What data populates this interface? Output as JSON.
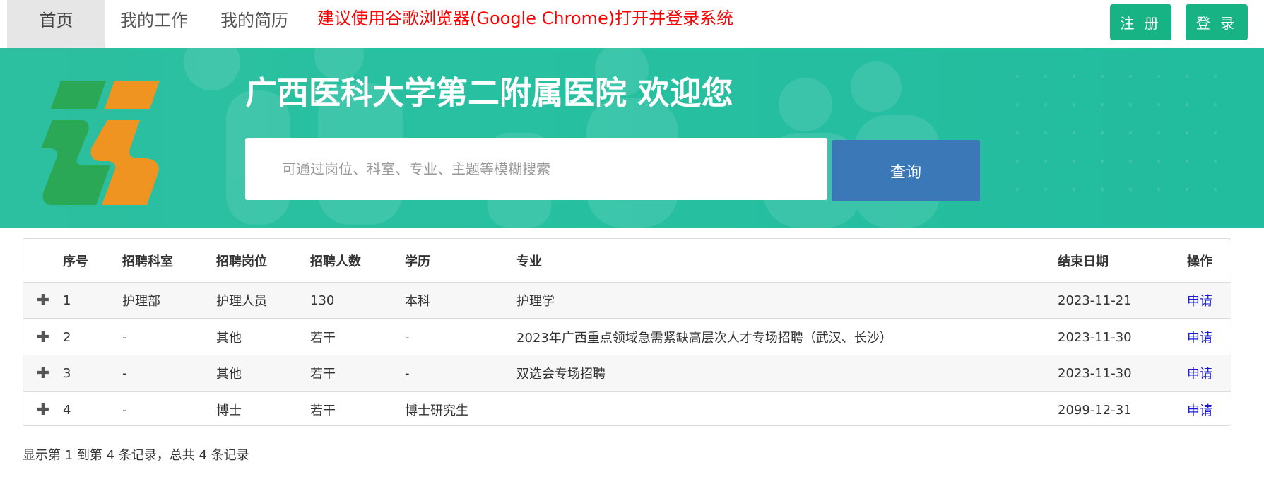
{
  "nav": {
    "home": "首页",
    "my_work": "我的工作",
    "my_resume": "我的简历",
    "notice": "建议使用谷歌浏览器(Google Chrome)打开并登录系统",
    "register": "注 册",
    "login": "登 录"
  },
  "banner": {
    "title": "广西医科大学第二附属医院 欢迎您",
    "search_placeholder": "可通过岗位、科室、专业、主题等模糊搜索",
    "search_button": "查询"
  },
  "table": {
    "headers": [
      "序号",
      "招聘科室",
      "招聘岗位",
      "招聘人数",
      "学历",
      "专业",
      "结束日期",
      "操作"
    ],
    "rows": [
      {
        "expand": "✚",
        "idx": "1",
        "dept": "护理部",
        "position": "护理人员",
        "count": "130",
        "education": "本科",
        "major": "护理学",
        "end_date": "2023-11-21",
        "action": "申请"
      },
      {
        "expand": "✚",
        "idx": "2",
        "dept": "-",
        "position": "其他",
        "count": "若干",
        "education": "-",
        "major": "2023年广西重点领域急需紧缺高层次人才专场招聘（武汉、长沙）",
        "end_date": "2023-11-30",
        "action": "申请"
      },
      {
        "expand": "✚",
        "idx": "3",
        "dept": "-",
        "position": "其他",
        "count": "若干",
        "education": "-",
        "major": "双选会专场招聘",
        "end_date": "2023-11-30",
        "action": "申请"
      },
      {
        "expand": "✚",
        "idx": "4",
        "dept": "-",
        "position": "博士",
        "count": "若干",
        "education": "博士研究生",
        "major": "",
        "end_date": "2099-12-31",
        "action": "申请"
      }
    ]
  },
  "footer": {
    "pagination_info": "显示第 1 到第 4 条记录，总共 4 条记录"
  },
  "colors": {
    "brand_green": "#17b384",
    "banner_teal": "#27c0a1",
    "search_blue": "#3a78b8",
    "notice_red": "#ff0000",
    "link_blue": "#1a1ad6"
  }
}
